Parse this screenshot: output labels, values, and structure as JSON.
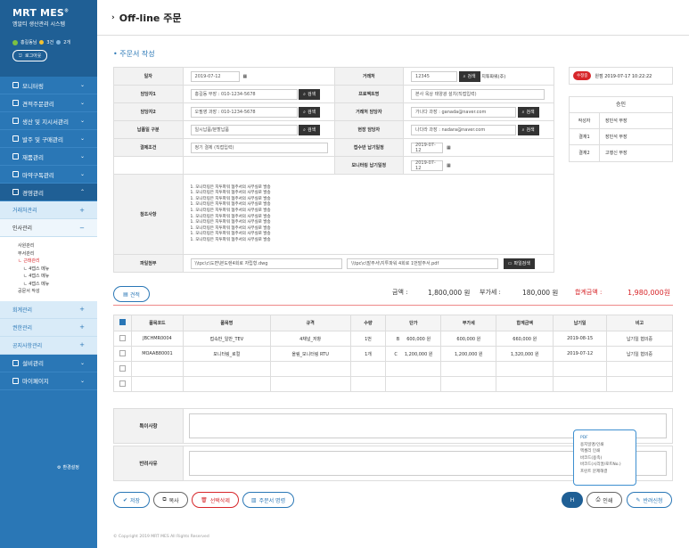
{
  "brand": {
    "title": "MRT MES",
    "title_sup": "®",
    "subtitle": "엠알티 생산관리 시스템"
  },
  "user": {
    "name": "홍길동님",
    "badge1": "3건",
    "badge2": "2개",
    "logout": "로그아웃"
  },
  "sidebar": {
    "items": [
      {
        "label": "모니터링"
      },
      {
        "label": "견적주문관리"
      },
      {
        "label": "생산 및 지시서관리"
      },
      {
        "label": "발주 및 구매관리"
      },
      {
        "label": "재품관리"
      },
      {
        "label": "마약구독관리"
      },
      {
        "label": "경영관리"
      }
    ],
    "sub": [
      {
        "label": "거래처관리"
      },
      {
        "label": "인사관리"
      }
    ],
    "tree": [
      "사원관리",
      "부서관리",
      "ㄴ 근태관리",
      "ㄴ 4뎁스 메뉴",
      "ㄴ 4뎁스 메뉴",
      "ㄴ 4뎁스 메뉴",
      "공문서 작성"
    ],
    "sub2": [
      {
        "label": "회계관리"
      },
      {
        "label": "권한관리"
      },
      {
        "label": "공지사항관리"
      }
    ],
    "items2": [
      {
        "label": "설비관리"
      },
      {
        "label": "마이페이지"
      }
    ],
    "settings": "환경설정"
  },
  "page": {
    "title": "Off-line 주문",
    "section": "주문서 작성"
  },
  "form": {
    "l_date": "일자",
    "date": "2019-07-12",
    "l_client": "거래처",
    "client": "12345",
    "client_btn": "검색",
    "client_note": "지투파워(주)",
    "l_mgr1": "담당자1",
    "mgr1": "홍길동 부장 : 010-1234-5678",
    "search": "검색",
    "l_project": "프로젝트명",
    "project": "본사 옥상 태양광 설치(직접입력)",
    "l_mgr2": "담당자2",
    "mgr2": "오필영 과장 : 010-1234-5678",
    "l_client_mgr": "거래처 담당자",
    "client_mgr": "가나다 과장 : ganada@naver.com",
    "l_delivery": "납품일 구분",
    "delivery": "일시납품/분할납품",
    "l_site_mgr": "현장 담당자",
    "site_mgr": "나다라 과장 : nadara@naver.com",
    "l_pay": "결제조건",
    "pay": "정기 결제 (직접입력)",
    "l_recv": "접수반 납기일정",
    "recv": "2019-07-12",
    "l_mon": "모니터링 납기일정",
    "mon": "2019-07-12",
    "l_ref": "참조사항",
    "ref_lines": [
      "1. 모니터링은 지투파워 협주서의 사무실로 발송",
      "1. 모니터링은 지투파워 협주서의 사무실로 발송",
      "1. 모니터링은 지투파워 협주서의 사무실로 발송",
      "1. 모니터링은 지투파워 협주서의 사무실로 발송",
      "1. 모니터링은 지투파워 협주서의 사무실로 발송",
      "1. 모니터링은 지투파워 협주서의 사무실로 발송",
      "1. 모니터링은 지투파워 협주서의 사무실로 발송",
      "1. 모니터링은 지투파워 협주서의 사무실로 발송",
      "1. 모니터링은 지투파워 협주서의 사무실로 발송",
      "1. 모니터링은 지투파워 협주서의 사무실로 발송"
    ],
    "l_attach": "파일첨부",
    "file1": "\\\\tpc\\c\\도면\\본도렌4회로 자립형.dwg",
    "file2": "\\\\tpc\\c\\발주서\\지투파워 4회로 1번발주서.pdf",
    "file_btn": "파일검색"
  },
  "approval": {
    "status": "수정중",
    "date": "원점 2019-07-17 10:22:22",
    "head": "승인",
    "rows": [
      {
        "k": "작성자",
        "v": "장민석 부장"
      },
      {
        "k": "결재1",
        "v": "장민석 부장"
      },
      {
        "k": "결재2",
        "v": "고행신 부장"
      }
    ]
  },
  "search_btn": "견적",
  "totals": {
    "l_amount": "금액 :",
    "amount": "1,800,000 원",
    "l_vat": "부가세 :",
    "vat": "180,000 원",
    "l_total": "합계금액 :",
    "total": "1,980,000원"
  },
  "grid": {
    "headers": [
      "품목코드",
      "품목명",
      "규격",
      "수량",
      "단가",
      "부가세",
      "합계금액",
      "납기일",
      "비고"
    ],
    "rows": [
      {
        "code": "JBCHMR0004",
        "name": "접속반_일반_TEV",
        "spec": "4채널_저항",
        "qty": "1번",
        "grade": "B",
        "price": "600,000 원",
        "vat": "600,000 원",
        "total": "660,000 원",
        "due": "2019-08-15",
        "note": "납기일 협의중"
      },
      {
        "code": "MOAAB80001",
        "name": "모니터링_로컬",
        "spec": "올림_모니터링 RTU",
        "qty": "1개",
        "grade": "C",
        "price": "1,200,000 원",
        "vat": "1,200,000 원",
        "total": "1,320,000 원",
        "due": "2019-07-12",
        "note": "납기일 협의중"
      }
    ]
  },
  "notes": {
    "special": "특이사항",
    "reject": "반려사유"
  },
  "buttons": {
    "save": "저장",
    "copy": "복사",
    "delete": "선택삭제",
    "list": "주문서 명령",
    "h": "H",
    "print": "인쇄",
    "cancel": "반려신청"
  },
  "print_menu": [
    "PDF",
    "용지일명/인쇄",
    "엑셀리 인쇄",
    "바코드(용족)",
    "바코드(시리얼/로트No.)",
    "프린트 문제해결"
  ],
  "colors": {
    "primary": "#2a77b6",
    "sidebar_dark": "#1f5f95",
    "accent_red": "#d7262a"
  },
  "footer": "© Copyright 2019 MRT MES All Rights Reserved"
}
